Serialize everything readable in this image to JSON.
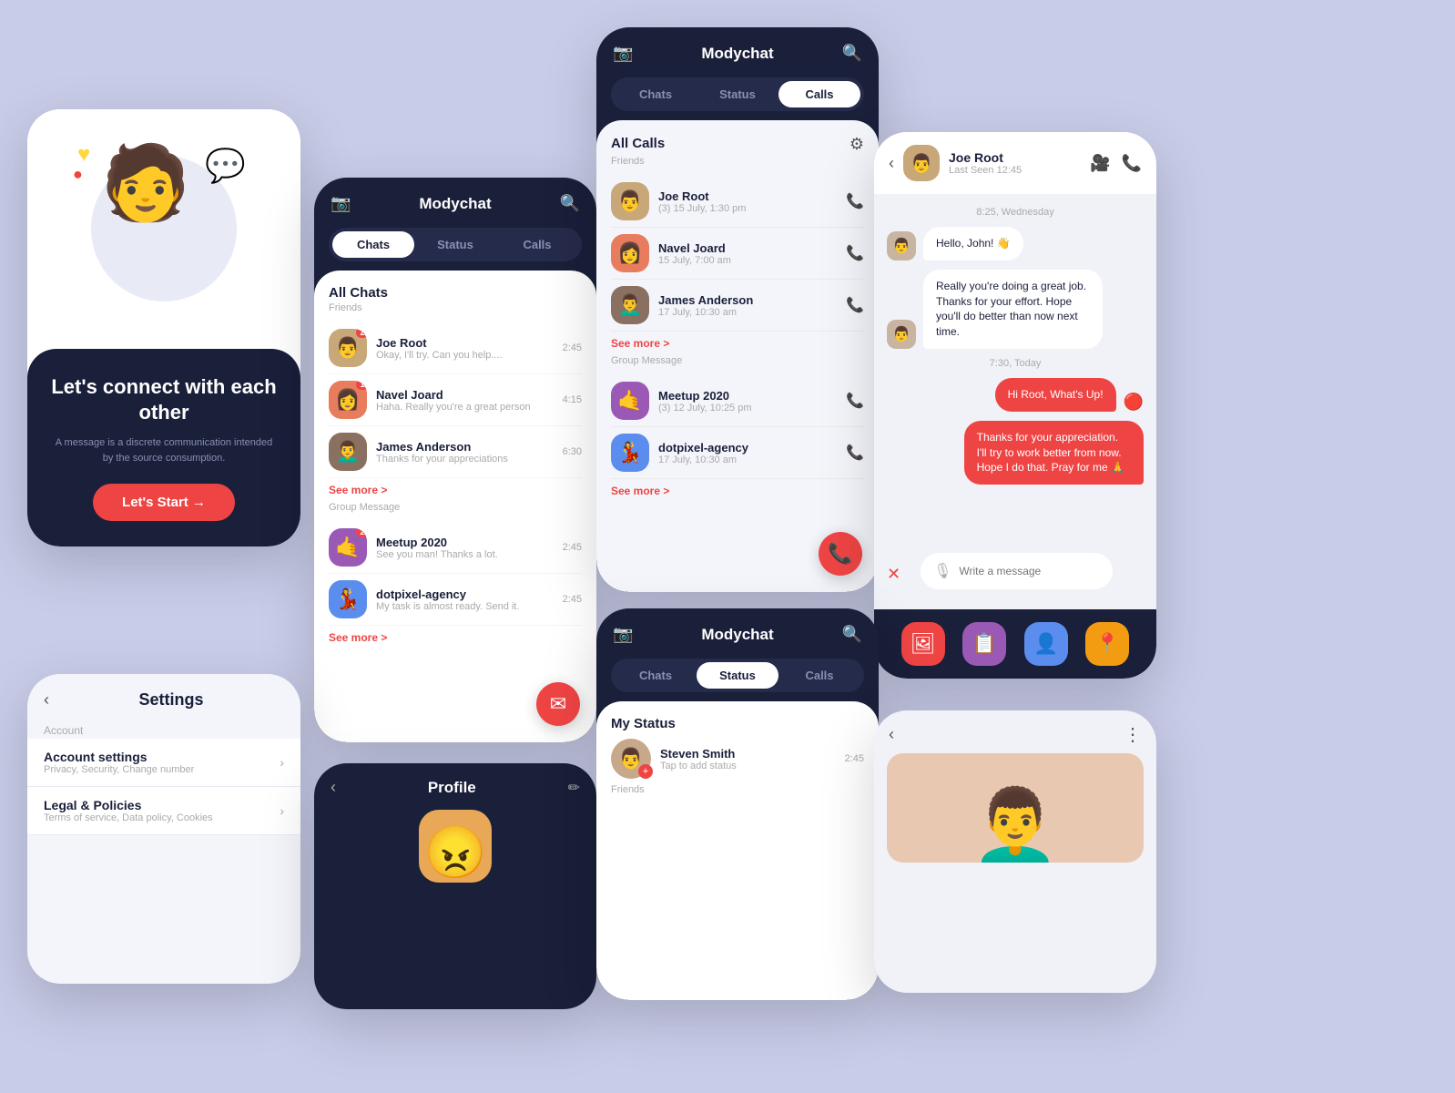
{
  "app": {
    "name": "Modychat",
    "camera_icon": "📷",
    "search_icon": "🔍",
    "filter_icon": "⚙",
    "back_icon": "‹",
    "tabs": [
      "Chats",
      "Status",
      "Calls"
    ]
  },
  "welcome": {
    "title": "Let's connect\nwith each other",
    "subtitle": "A message is a discrete communication intended by the source consumption.",
    "cta": "Let's Start →"
  },
  "chats_screen": {
    "header": "Modychat",
    "active_tab": "Chats",
    "all_chats_label": "All Chats",
    "friends_label": "Friends",
    "group_label": "Group Message",
    "see_more": "See more >",
    "friends": [
      {
        "name": "Joe Root",
        "preview": "Okay, I'll try. Can you help....",
        "time": "2:45",
        "badge": "2",
        "emoji": "👨"
      },
      {
        "name": "Navel Joard",
        "preview": "Haha. Really you're a great person",
        "time": "4:15",
        "badge": "1",
        "emoji": "👩"
      },
      {
        "name": "James Anderson",
        "preview": "Thanks for your appreciations",
        "time": "6:30",
        "badge": "",
        "emoji": "👨‍🦱"
      }
    ],
    "groups": [
      {
        "name": "Meetup 2020",
        "preview": "See you man! Thanks a lot.",
        "time": "2:45",
        "badge": "2",
        "emoji": "🤙"
      },
      {
        "name": "dotpixel-agency",
        "preview": "My task is almost ready. Send it.",
        "time": "2:45",
        "badge": "",
        "emoji": "💃"
      }
    ]
  },
  "calls_screen": {
    "header": "Modychat",
    "active_tab": "Calls",
    "all_calls_label": "All Calls",
    "friends_label": "Friends",
    "group_label": "Group Message",
    "see_more_friends": "See more >",
    "see_more_groups": "See more >",
    "friends": [
      {
        "name": "Joe Root",
        "time": "(3) 15 July, 1:30 pm",
        "emoji": "👨",
        "missed": true
      },
      {
        "name": "Navel Joard",
        "time": "15 July, 7:00 am",
        "emoji": "👩",
        "missed": false
      },
      {
        "name": "James Anderson",
        "time": "17 July, 10:30 am",
        "emoji": "👨‍🦱",
        "missed": false
      }
    ],
    "groups": [
      {
        "name": "Meetup 2020",
        "time": "(3) 12 July, 10:25 pm",
        "emoji": "🤙",
        "missed": true
      },
      {
        "name": "dotpixel-agency",
        "time": "17 July, 10:30 am",
        "emoji": "💃",
        "missed": false
      }
    ]
  },
  "conversation": {
    "contact_name": "Joe Root",
    "last_seen": "Last Seen 12:45",
    "date_label": "8:25, Wednesday",
    "today_label": "7:30, Today",
    "messages": [
      {
        "type": "received",
        "text": "Hello, John! 👋"
      },
      {
        "type": "received",
        "text": "Really you're doing a great job. Thanks for your effort. Hope you'll do better than now next time."
      },
      {
        "type": "sent",
        "text": "Hi Root, What's Up!"
      },
      {
        "type": "sent",
        "text": "Thanks for your appreciation. I'll try to work better from now. Hope I do that. Pray for me 🙏"
      }
    ],
    "input_placeholder": "Write a message",
    "bottom_actions": [
      "🖼",
      "📋",
      "👤",
      "📍"
    ]
  },
  "settings": {
    "title": "Settings",
    "account_label": "Account",
    "items": [
      {
        "name": "Account settings",
        "desc": "Privacy, Security, Change number"
      },
      {
        "name": "Legal & Policies",
        "desc": "Terms of service, Data policy, Cookies"
      }
    ]
  },
  "profile": {
    "title": "Profile",
    "edit_icon": "✏"
  },
  "status_screen": {
    "header": "Modychat",
    "active_tab": "Status",
    "my_status_label": "My Status",
    "friends_label": "Friends",
    "my_status": {
      "name": "Steven Smith",
      "time": "2:45",
      "tap_label": "Tap to add status",
      "emoji": "👨"
    }
  },
  "recent": {
    "more_icon": "⋮"
  },
  "colors": {
    "primary": "#ef4444",
    "dark_bg": "#1a1f3a",
    "light_bg": "#f4f5fb",
    "accent_blue": "#5b8dee",
    "text_main": "#1a1f3a",
    "text_muted": "#aaa"
  }
}
